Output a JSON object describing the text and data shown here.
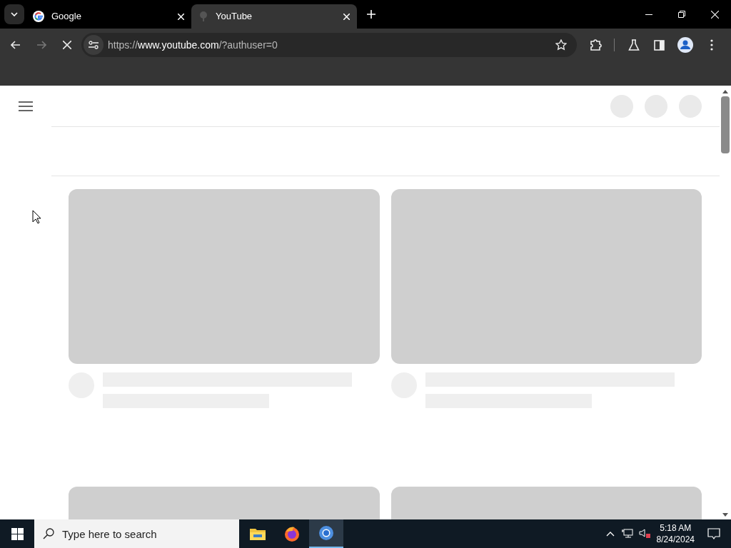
{
  "tabs": [
    {
      "title": "Google",
      "selected": false,
      "loading": false
    },
    {
      "title": "YouTube",
      "selected": true,
      "loading": true
    }
  ],
  "address_bar": {
    "scheme": "https://",
    "host": "www.youtube.com",
    "rest": "/?authuser=0"
  },
  "page_loading": true,
  "taskbar": {
    "search": {
      "placeholder": "Type here to search"
    },
    "apps": [
      {
        "kind": "folder",
        "selected": false
      },
      {
        "kind": "firefox",
        "selected": false
      },
      {
        "kind": "chrome",
        "selected": true
      }
    ],
    "time": "5:18 AM",
    "date": "8/24/2024"
  }
}
